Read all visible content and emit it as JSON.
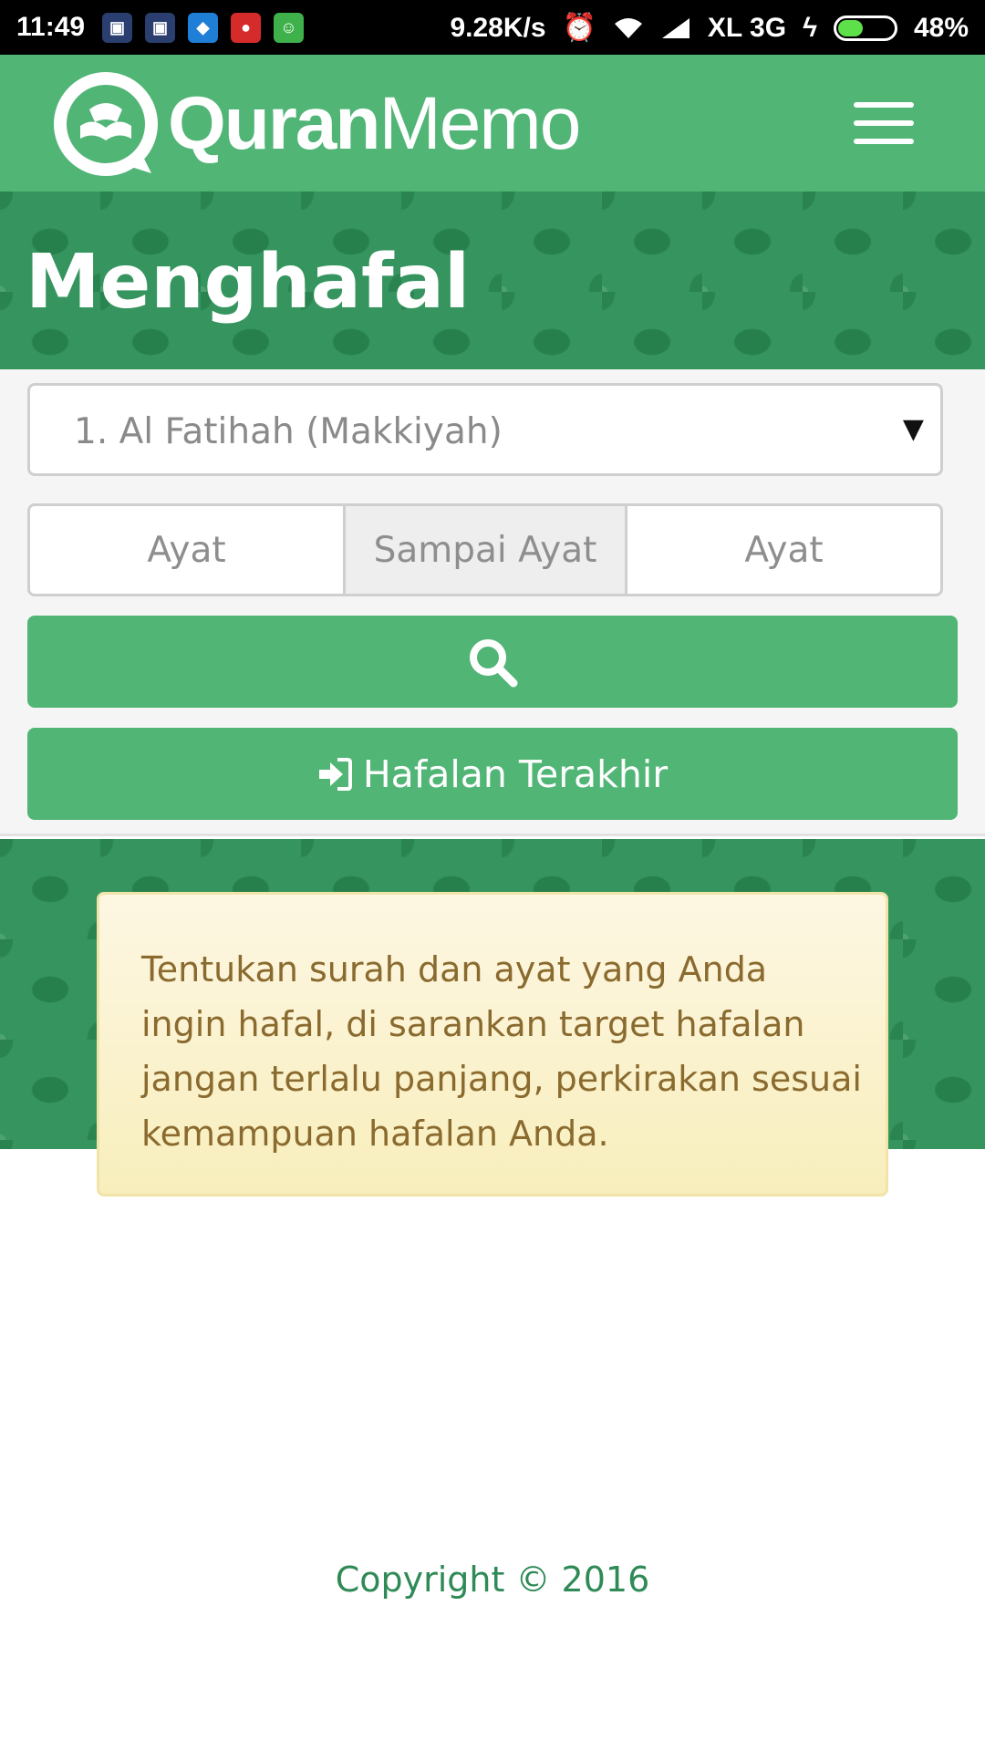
{
  "status_bar": {
    "time": "11:49",
    "network_speed": "9.28K/s",
    "carrier": "XL 3G",
    "battery": "48%",
    "battery_level": 0.48
  },
  "navbar": {
    "logo_bold": "Quran",
    "logo_light": "Memo"
  },
  "header": {
    "title": "Menghafal"
  },
  "form": {
    "surah_select": "1. Al Fatihah (Makkiyah)",
    "ayat_from_placeholder": "Ayat",
    "ayat_separator": "Sampai Ayat",
    "ayat_to_placeholder": "Ayat",
    "last_memorization_label": "Hafalan Terakhir"
  },
  "notice": {
    "text": "Tentukan surah dan ayat yang Anda ingin hafal, di sarankan target hafalan jangan terlalu panjang, perkirakan sesuai kemampuan hafalan Anda."
  },
  "footer": {
    "copyright": "Copyright © 2016"
  },
  "colors": {
    "brand_green": "#51b576",
    "pattern_green": "#36955f",
    "notice_text": "#8a6a2e"
  }
}
